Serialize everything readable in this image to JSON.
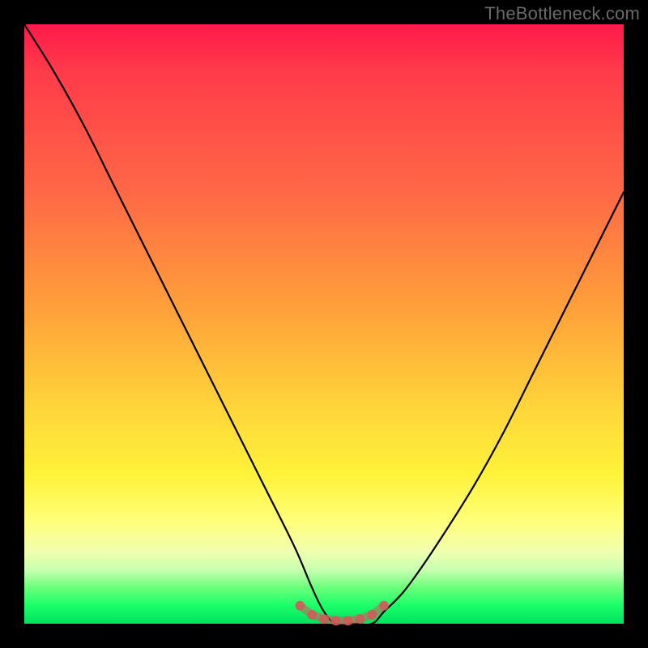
{
  "watermark": "TheBottleneck.com",
  "colors": {
    "background": "#000000",
    "watermark": "#6a6a6a",
    "curve": "#000000",
    "marker": "#d15a5a",
    "gradient_stops": [
      "#ff1a4a",
      "#ff3b4a",
      "#ff6846",
      "#ffa23a",
      "#ffd23a",
      "#fff23a",
      "#ffff7a",
      "#f0ffb0",
      "#c8ffb0",
      "#6aff7a",
      "#1aff6a",
      "#00e060"
    ]
  },
  "chart_data": {
    "type": "line",
    "title": "",
    "xlabel": "",
    "ylabel": "",
    "xlim": [
      0,
      100
    ],
    "ylim": [
      0,
      100
    ],
    "series": [
      {
        "name": "curve",
        "x": [
          0,
          5,
          10,
          15,
          20,
          25,
          30,
          35,
          40,
          45,
          48,
          50,
          52,
          55,
          58,
          60,
          63,
          66,
          70,
          75,
          80,
          85,
          90,
          95,
          100
        ],
        "y": [
          100,
          92,
          83,
          73,
          63,
          53,
          43,
          33,
          23,
          13,
          6,
          2,
          0,
          0,
          0,
          2,
          5,
          9,
          15,
          23,
          32,
          42,
          52,
          62,
          72
        ]
      }
    ],
    "markers": {
      "name": "bottom-cluster",
      "x": [
        46,
        48,
        50,
        52,
        54,
        56,
        58,
        60
      ],
      "y": [
        3,
        1.5,
        0.8,
        0.5,
        0.5,
        0.8,
        1.5,
        3
      ]
    }
  }
}
